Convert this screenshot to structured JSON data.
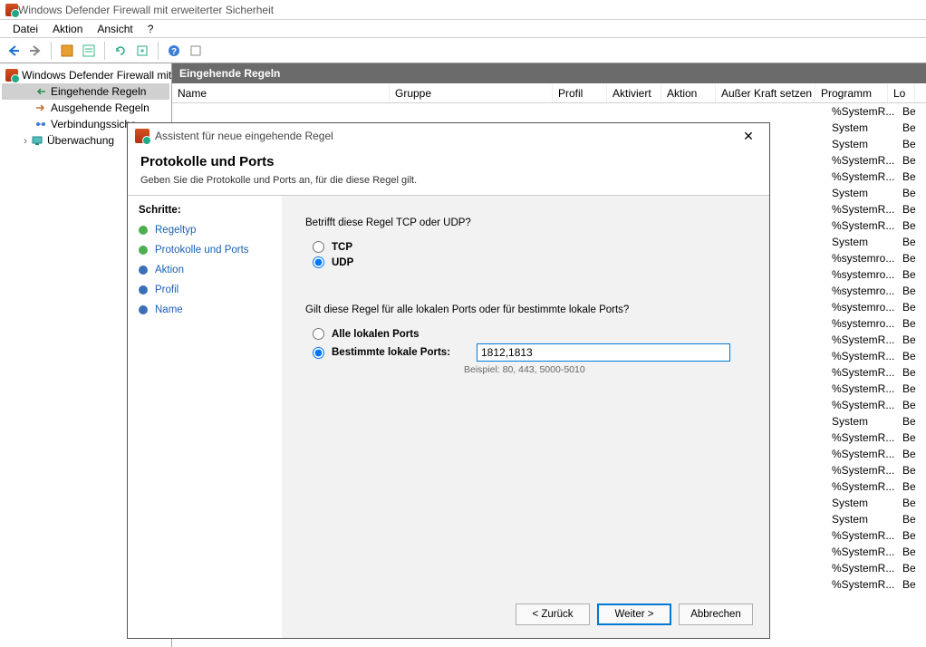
{
  "window": {
    "title": "Windows Defender Firewall mit erweiterter Sicherheit"
  },
  "menu": {
    "datei": "Datei",
    "aktion": "Aktion",
    "ansicht": "Ansicht",
    "help": "?"
  },
  "tree": {
    "root": "Windows Defender Firewall mit",
    "inbound": "Eingehende Regeln",
    "outbound": "Ausgehende Regeln",
    "connsec": "Verbindungssiche",
    "monitor": "Überwachung"
  },
  "content": {
    "header": "Eingehende Regeln",
    "columns": {
      "name": "Name",
      "gruppe": "Gruppe",
      "profil": "Profil",
      "aktiviert": "Aktiviert",
      "aktion": "Aktion",
      "ausser": "Außer Kraft setzen",
      "programm": "Programm",
      "lo": "Lo"
    },
    "rows": [
      {
        "programm": "%SystemR...",
        "lo": "Be"
      },
      {
        "programm": "System",
        "lo": "Be"
      },
      {
        "programm": "System",
        "lo": "Be"
      },
      {
        "programm": "%SystemR...",
        "lo": "Be"
      },
      {
        "programm": "%SystemR...",
        "lo": "Be"
      },
      {
        "programm": "System",
        "lo": "Be"
      },
      {
        "programm": "%SystemR...",
        "lo": "Be"
      },
      {
        "programm": "%SystemR...",
        "lo": "Be"
      },
      {
        "programm": "System",
        "lo": "Be"
      },
      {
        "programm": "%systemro...",
        "lo": "Be"
      },
      {
        "programm": "%systemro...",
        "lo": "Be"
      },
      {
        "programm": "%systemro...",
        "lo": "Be"
      },
      {
        "programm": "%systemro...",
        "lo": "Be"
      },
      {
        "programm": "%systemro...",
        "lo": "Be"
      },
      {
        "programm": "%SystemR...",
        "lo": "Be"
      },
      {
        "programm": "%SystemR...",
        "lo": "Be"
      },
      {
        "programm": "%SystemR...",
        "lo": "Be"
      },
      {
        "programm": "%SystemR...",
        "lo": "Be"
      },
      {
        "programm": "%SystemR...",
        "lo": "Be"
      },
      {
        "programm": "System",
        "lo": "Be"
      },
      {
        "programm": "%SystemR...",
        "lo": "Be"
      },
      {
        "programm": "%SystemR...",
        "lo": "Be"
      },
      {
        "programm": "%SystemR...",
        "lo": "Be"
      },
      {
        "programm": "%SystemR...",
        "lo": "Be"
      },
      {
        "programm": "System",
        "lo": "Be"
      },
      {
        "programm": "System",
        "lo": "Be"
      },
      {
        "programm": "%SystemR...",
        "lo": "Be"
      },
      {
        "programm": "%SystemR...",
        "lo": "Be"
      },
      {
        "programm": "%SystemR...",
        "lo": "Be"
      },
      {
        "programm": "%SystemR...",
        "lo": "Be"
      }
    ]
  },
  "wizard": {
    "title": "Assistent für neue eingehende Regel",
    "heading": "Protokolle und Ports",
    "subheading": "Geben Sie die Protokolle und Ports an, für die diese Regel gilt.",
    "steps_label": "Schritte:",
    "steps": {
      "regeltyp": "Regeltyp",
      "protokolle": "Protokolle und Ports",
      "aktion": "Aktion",
      "profil": "Profil",
      "name": "Name"
    },
    "q_tcpudp": "Betrifft diese Regel TCP oder UDP?",
    "opt_tcp": "TCP",
    "opt_udp": "UDP",
    "q_ports": "Gilt diese Regel für alle lokalen Ports oder für bestimmte lokale Ports?",
    "opt_allports": "Alle lokalen Ports",
    "opt_specports": "Bestimmte lokale Ports:",
    "ports_value": "1812,1813",
    "ports_example": "Beispiel: 80, 443, 5000-5010",
    "btn_back": "< Zurück",
    "btn_next": "Weiter >",
    "btn_cancel": "Abbrechen"
  }
}
